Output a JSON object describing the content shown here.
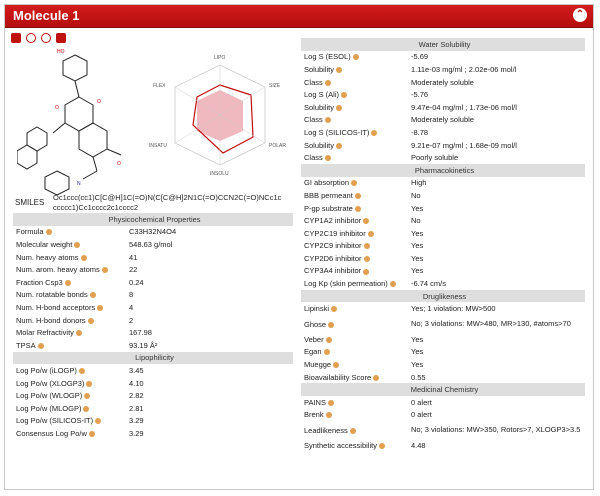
{
  "window": {
    "title": "Molecule 1"
  },
  "smiles": {
    "label": "SMILES",
    "value": "Oc1ccc(cc1)C[C@H]1C(=O)N(C[C@H]2N1C(=O)CCN2C(=O)NCc1c ccccc1)Cc1cccc2c1cccc2"
  },
  "radar_labels": [
    "LIPO",
    "SIZE",
    "POLAR",
    "INSOLU",
    "INSATU",
    "FLEX"
  ],
  "physchem": {
    "header": "Physicochemical Properties",
    "rows": [
      [
        "Formula",
        "C33H32N4O4"
      ],
      [
        "Molecular weight",
        "548.63 g/mol"
      ],
      [
        "Num. heavy atoms",
        "41"
      ],
      [
        "Num. arom. heavy atoms",
        "22"
      ],
      [
        "Fraction Csp3",
        "0.24"
      ],
      [
        "Num. rotatable bonds",
        "8"
      ],
      [
        "Num. H-bond acceptors",
        "4"
      ],
      [
        "Num. H-bond donors",
        "2"
      ],
      [
        "Molar Refractivity",
        "167.98"
      ],
      [
        "TPSA",
        "93.19 Å²"
      ]
    ]
  },
  "lipo": {
    "header": "Lipophilicity",
    "rows": [
      [
        "Log Po/w (iLOGP)",
        "3.45"
      ],
      [
        "Log Po/w (XLOGP3)",
        "4.10"
      ],
      [
        "Log Po/w (WLOGP)",
        "2.82"
      ],
      [
        "Log Po/w (MLOGP)",
        "2.81"
      ],
      [
        "Log Po/w (SILICOS-IT)",
        "3.29"
      ],
      [
        "Consensus Log Po/w",
        "3.29"
      ]
    ]
  },
  "water": {
    "header": "Water Solubility",
    "rows": [
      [
        "Log S (ESOL)",
        "-5.69"
      ],
      [
        "Solubility",
        "1.11e-03 mg/ml ; 2.02e-06 mol/l"
      ],
      [
        "Class",
        "Moderately soluble"
      ],
      [
        "Log S (Ali)",
        "-5.76"
      ],
      [
        "Solubility",
        "9.47e-04 mg/ml ; 1.73e-06 mol/l"
      ],
      [
        "Class",
        "Moderately soluble"
      ],
      [
        "Log S (SILICOS-IT)",
        "-8.78"
      ],
      [
        "Solubility",
        "9.21e-07 mg/ml ; 1.68e-09 mol/l"
      ],
      [
        "Class",
        "Poorly soluble"
      ]
    ]
  },
  "pk": {
    "header": "Pharmacokinetics",
    "rows": [
      [
        "GI absorption",
        "High"
      ],
      [
        "BBB permeant",
        "No"
      ],
      [
        "P-gp substrate",
        "Yes"
      ],
      [
        "CYP1A2 inhibitor",
        "No"
      ],
      [
        "CYP2C19 inhibitor",
        "Yes"
      ],
      [
        "CYP2C9 inhibitor",
        "Yes"
      ],
      [
        "CYP2D6 inhibitor",
        "Yes"
      ],
      [
        "CYP3A4 inhibitor",
        "Yes"
      ],
      [
        "Log Kp (skin permeation)",
        "-6.74 cm/s"
      ]
    ]
  },
  "drug": {
    "header": "Druglikeness",
    "rows": [
      [
        "Lipinski",
        "Yes; 1 violation: MW>500"
      ],
      [
        "Ghose",
        "No; 3 violations: MW>480, MR>130, #atoms>70"
      ],
      [
        "Veber",
        "Yes"
      ],
      [
        "Egan",
        "Yes"
      ],
      [
        "Muegge",
        "Yes"
      ],
      [
        "Bioavailability Score",
        "0.55"
      ]
    ]
  },
  "medchem": {
    "header": "Medicinal Chemistry",
    "rows": [
      [
        "PAINS",
        "0 alert"
      ],
      [
        "Brenk",
        "0 alert"
      ],
      [
        "Leadlikeness",
        "No; 3 violations: MW>350, Rotors>7, XLOGP3>3.5"
      ],
      [
        "Synthetic accessibility",
        "4.48"
      ]
    ]
  }
}
